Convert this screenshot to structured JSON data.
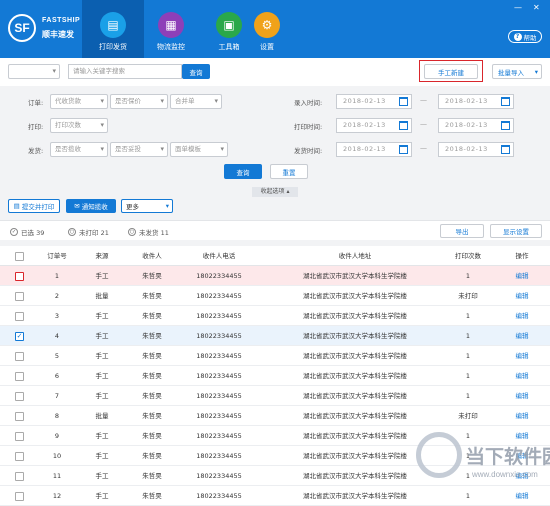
{
  "brand": {
    "logo": "SF",
    "name_en": "FASTSHIP",
    "name_cn": "顺丰速发"
  },
  "nav": [
    {
      "label": "打印发货",
      "icon": "printer-icon"
    },
    {
      "label": "物流监控",
      "icon": "monitor-icon"
    },
    {
      "label": "工具箱",
      "icon": "toolbox-icon"
    },
    {
      "label": "设置",
      "icon": "gear-icon"
    }
  ],
  "window": {
    "minimize": "—",
    "close": "✕"
  },
  "help": "帮助",
  "search": {
    "placeholder": "请输入关键字搜索",
    "button": "查询"
  },
  "manual_create": "手工新建",
  "batch_import": "批量导入",
  "filter": {
    "order_label": "订单:",
    "order_opts": [
      "代收货款",
      "是否保价",
      "合并单"
    ],
    "print_label": "打印:",
    "print_opt": "打印次数",
    "ship_label": "发货:",
    "ship_opts": [
      "是否揽收",
      "是否妥投",
      "面单模板"
    ],
    "entry_time": "录入时间:",
    "print_time": "打印时间:",
    "ship_time": "发货时间:",
    "date": "2018-02-13",
    "dash": "—",
    "query": "查询",
    "reset": "重置",
    "collapse": "收起选项 ▴"
  },
  "actions": {
    "submit_print": "提交并打印",
    "notify_pickup": "通知揽收",
    "more": "更多"
  },
  "stats": {
    "selected": "已选 39",
    "unprinted": "未打印 21",
    "unshipped": "未发货 11",
    "export": "导出",
    "display_settings": "显示设置"
  },
  "columns": [
    "订单号",
    "来源",
    "收件人",
    "收件人电话",
    "收件人地址",
    "打印次数",
    "操作"
  ],
  "rows": [
    [
      "1",
      "手工",
      "朱哲昊",
      "18022334455",
      "湖北省武汉市武汉大学本科生学院楼",
      "1",
      "编辑"
    ],
    [
      "2",
      "批量",
      "朱哲昊",
      "18022334455",
      "湖北省武汉市武汉大学本科生学院楼",
      "未打印",
      "编辑"
    ],
    [
      "3",
      "手工",
      "朱哲昊",
      "18022334455",
      "湖北省武汉市武汉大学本科生学院楼",
      "1",
      "编辑"
    ],
    [
      "4",
      "手工",
      "朱哲昊",
      "18022334455",
      "湖北省武汉市武汉大学本科生学院楼",
      "1",
      "编辑"
    ],
    [
      "5",
      "手工",
      "朱哲昊",
      "18022334455",
      "湖北省武汉市武汉大学本科生学院楼",
      "1",
      "编辑"
    ],
    [
      "6",
      "手工",
      "朱哲昊",
      "18022334455",
      "湖北省武汉市武汉大学本科生学院楼",
      "1",
      "编辑"
    ],
    [
      "7",
      "手工",
      "朱哲昊",
      "18022334455",
      "湖北省武汉市武汉大学本科生学院楼",
      "1",
      "编辑"
    ],
    [
      "8",
      "批量",
      "朱哲昊",
      "18022334455",
      "湖北省武汉市武汉大学本科生学院楼",
      "未打印",
      "编辑"
    ],
    [
      "9",
      "手工",
      "朱哲昊",
      "18022334455",
      "湖北省武汉市武汉大学本科生学院楼",
      "1",
      "编辑"
    ],
    [
      "10",
      "手工",
      "朱哲昊",
      "18022334455",
      "湖北省武汉市武汉大学本科生学院楼",
      "1",
      "编辑"
    ],
    [
      "11",
      "手工",
      "朱哲昊",
      "18022334455",
      "湖北省武汉市武汉大学本科生学院楼",
      "1",
      "编辑"
    ],
    [
      "12",
      "手工",
      "朱哲昊",
      "18022334455",
      "湖北省武汉市武汉大学本科生学院楼",
      "1",
      "编辑"
    ]
  ],
  "watermark": {
    "text": "当下软件园",
    "url": "www.downxia.com"
  },
  "colors": {
    "primary": "#1379d5",
    "highlight_row": "#fde8ea",
    "selected_row": "#eaf3fc",
    "alert": "#d9262c"
  }
}
